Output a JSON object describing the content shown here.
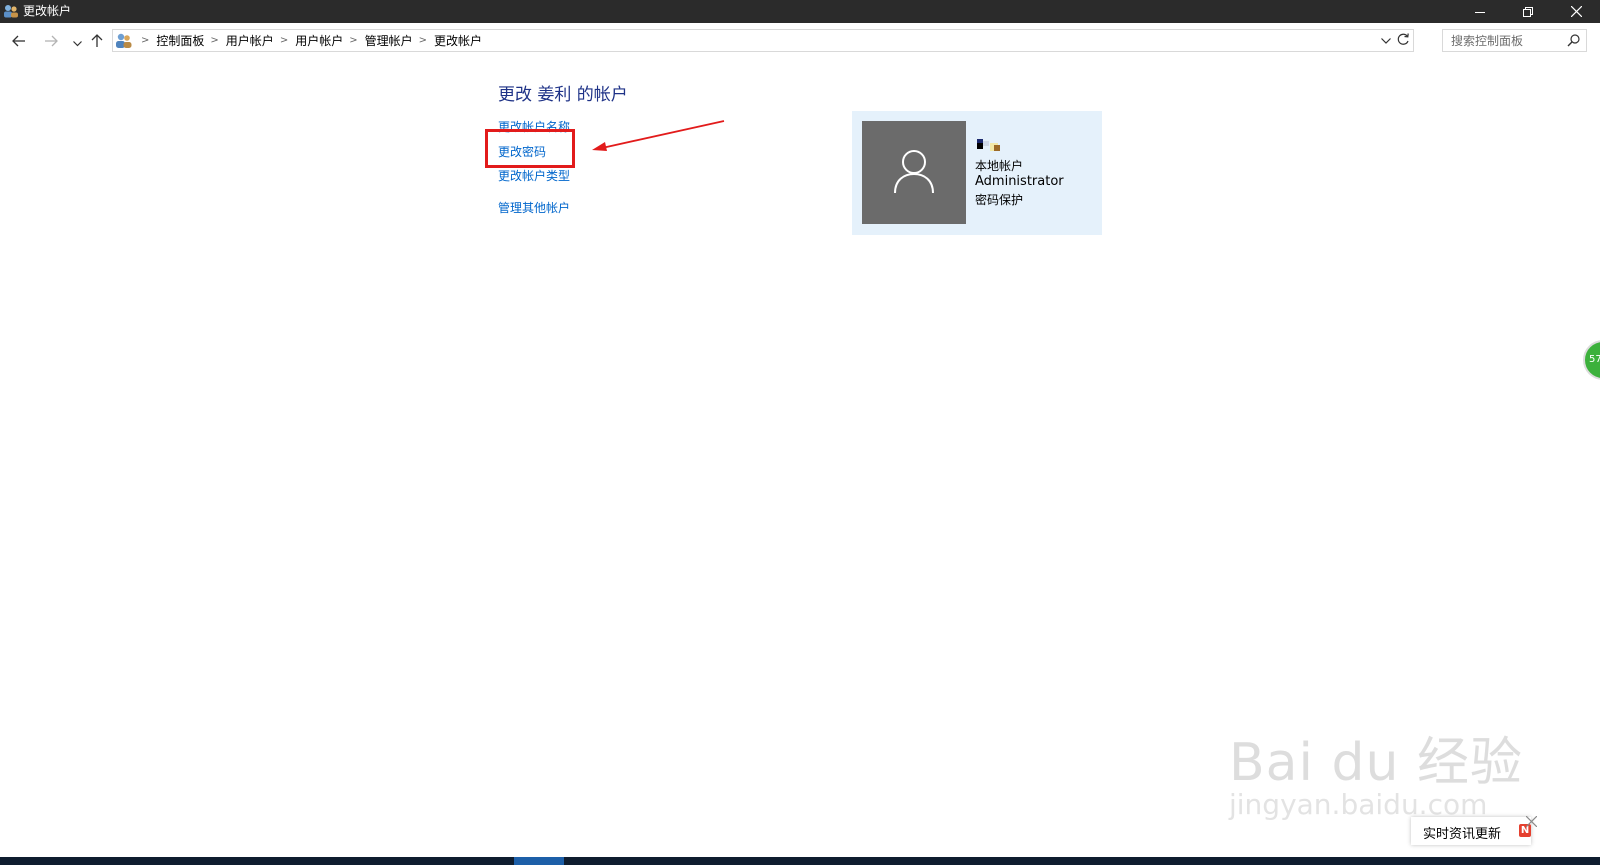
{
  "window": {
    "title": "更改帐户"
  },
  "breadcrumb": [
    "控制面板",
    "用户帐户",
    "用户帐户",
    "管理帐户",
    "更改帐户"
  ],
  "search": {
    "placeholder": "搜索控制面板"
  },
  "main": {
    "heading": "更改 姜利 的帐户",
    "tasks": [
      {
        "label": "更改帐户名称"
      },
      {
        "label": "更改密码"
      },
      {
        "label": "更改帐户类型"
      },
      {
        "label": "管理其他帐户"
      }
    ]
  },
  "account": {
    "type": "本地帐户",
    "role": "Administrator",
    "status": "密码保护"
  },
  "side_widget": {
    "text": "57"
  },
  "watermark": {
    "brand": "Bai du 经验",
    "url": "jingyan.baidu.com"
  },
  "news": {
    "label": "实时资讯更新",
    "badge": "N"
  },
  "colors": {
    "titlebar": "#2b2b2b",
    "link": "#0066cc",
    "heading": "#1e3287",
    "highlight": "#e21b1b",
    "card": "#e5f1fb",
    "avatar_bg": "#6b6b6b"
  },
  "icons": {
    "app": "users-icon",
    "back": "arrow-left-icon",
    "forward": "arrow-right-icon",
    "recent": "chevron-down-icon",
    "up": "arrow-up-icon",
    "control_panel": "control-panel-icon",
    "refresh": "refresh-icon",
    "search": "search-icon",
    "minimize": "minimize-icon",
    "restore": "restore-icon",
    "close": "close-icon",
    "avatar": "user-avatar-icon"
  }
}
